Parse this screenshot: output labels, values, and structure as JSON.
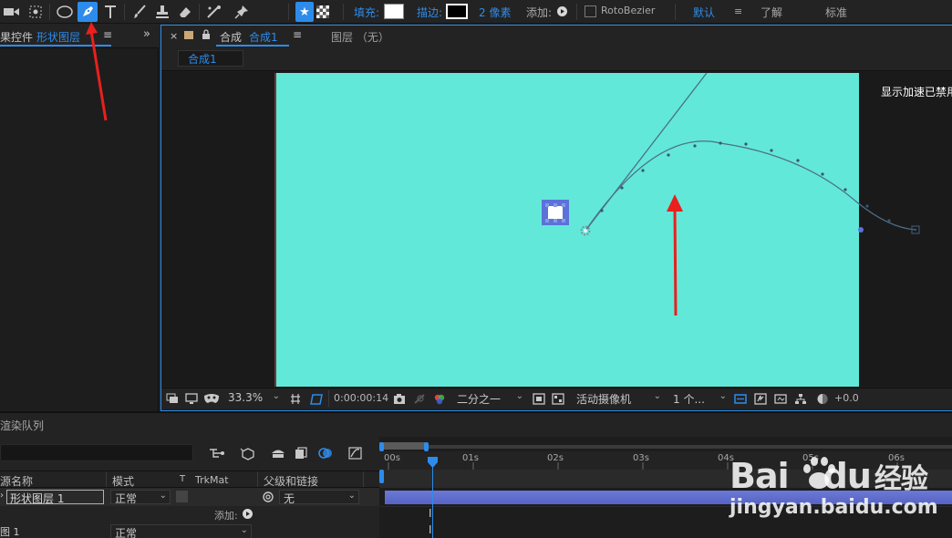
{
  "toolbar": {
    "fill_label": "填充:",
    "stroke_label": "描边:",
    "stroke_width": "2 像素",
    "add_label": "添加:",
    "rotobezier_label": "RotoBezier",
    "default_label": "默认",
    "learn_label": "了解",
    "standard_label": "标准",
    "accent_color": "#2d8ceb"
  },
  "left_panel": {
    "tab_prefix": "果控件",
    "tab_layer": "形状图层",
    "menu_icon": "≡",
    "expand_icon": "»"
  },
  "comp_panel": {
    "close": "×",
    "tab_label": "合成",
    "tab_name": "合成1",
    "menu_icon": "≡",
    "layer_tab": "图层 （无）",
    "sub_tab": "合成1",
    "gpu_notice": "显示加速已禁用",
    "canvas_color": "#62e8d8"
  },
  "viewer_bottom": {
    "zoom": "33.3%",
    "timecode": "0:00:00:14",
    "resolution": "二分之一",
    "camera": "活动摄像机",
    "views": "1 个...",
    "exposure": "+0.0"
  },
  "timeline": {
    "render_queue_tab": "渲染队列",
    "col_source_name": "源名称",
    "col_mode": "模式",
    "col_t": "T",
    "col_trkmat": "TrkMat",
    "col_parent": "父级和链接",
    "layer1_name": "形状图层 1",
    "layer1_mode": "正常",
    "layer1_parent": "无",
    "add_label": "添加:",
    "layer2_name": "图 1",
    "layer2_mode": "正常",
    "ticks": [
      "00s",
      "01s",
      "02s",
      "03s",
      "04s",
      "05s",
      "06s"
    ]
  },
  "watermark": {
    "brand": "Bai",
    "brand2": "du",
    "brand_cn": "经验",
    "url": "jingyan.baidu.com"
  }
}
